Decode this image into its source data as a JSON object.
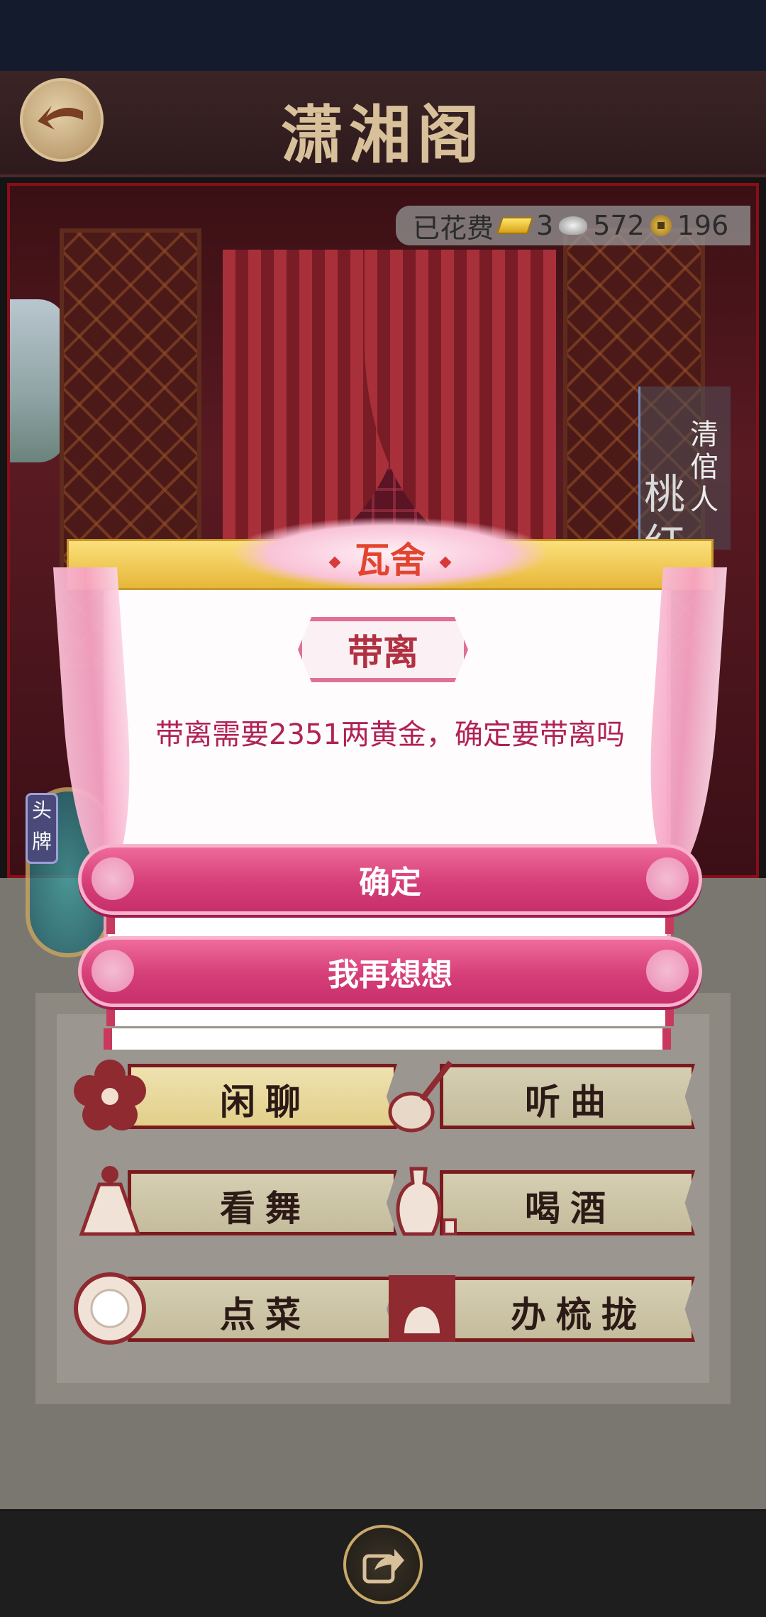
{
  "header": {
    "title": "潇湘阁",
    "back_icon": "back-arrow-icon"
  },
  "scene": {
    "spent_label": "已花费",
    "gold": "3",
    "silver": "572",
    "copper": "196",
    "side_title": "清倌人",
    "side_name": "桃红",
    "head_tab": "头牌"
  },
  "dialog": {
    "header": "瓦舍",
    "subtitle": "带离",
    "message": "带离需要2351两黄金，确定要带离吗",
    "confirm_label": "确定",
    "cancel_label": "我再想想"
  },
  "menu": {
    "items": [
      {
        "label": "闲聊",
        "icon": "flower-icon"
      },
      {
        "label": "听曲",
        "icon": "pipa-icon"
      },
      {
        "label": "看舞",
        "icon": "dancer-icon"
      },
      {
        "label": "喝酒",
        "icon": "wine-jug-icon"
      },
      {
        "label": "点菜",
        "icon": "dish-icon"
      },
      {
        "label": "办梳拢",
        "icon": "mirror-icon"
      }
    ]
  },
  "footer": {
    "share_icon": "share-icon"
  },
  "colors": {
    "accent_pink": "#d63e78",
    "dialog_text": "#b02255",
    "header_red": "#e3442f",
    "title_gold": "#d8c09a"
  }
}
